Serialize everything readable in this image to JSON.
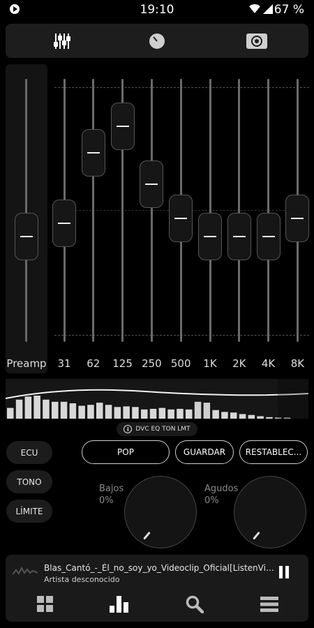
{
  "status": {
    "time": "19:10",
    "battery": "67 %"
  },
  "top_tabs": [
    {
      "name": "equalizer",
      "icon": "sliders-icon"
    },
    {
      "name": "tone",
      "icon": "dial-icon"
    },
    {
      "name": "surround",
      "icon": "speaker-icon"
    }
  ],
  "eq": {
    "preamp_label": "Preamp",
    "preamp_level": 0.4,
    "bands": [
      {
        "label": "31",
        "level": 0.45
      },
      {
        "label": "62",
        "level": 0.72
      },
      {
        "label": "125",
        "level": 0.82
      },
      {
        "label": "250",
        "level": 0.6
      },
      {
        "label": "500",
        "level": 0.47
      },
      {
        "label": "1K",
        "level": 0.4
      },
      {
        "label": "2K",
        "level": 0.4
      },
      {
        "label": "4K",
        "level": 0.4
      },
      {
        "label": "8K",
        "level": 0.47
      }
    ]
  },
  "spectrum_levels": [
    0.35,
    0.62,
    0.72,
    0.75,
    0.62,
    0.55,
    0.55,
    0.5,
    0.42,
    0.45,
    0.52,
    0.45,
    0.38,
    0.4,
    0.38,
    0.3,
    0.32,
    0.35,
    0.3,
    0.32,
    0.3,
    0.55,
    0.52,
    0.28,
    0.22,
    0.2,
    0.15,
    0.12,
    0.08,
    0.05,
    0.03,
    0.02
  ],
  "dvc_chip": "DVC EQ TON LMT",
  "side_buttons": {
    "ecu": "ECU",
    "tono": "TONO",
    "limite": "LÍMITE"
  },
  "preset_buttons": {
    "pop": "POP",
    "guardar": "GUARDAR",
    "restablecer": "RESTABLEC..."
  },
  "bass": {
    "label": "Bajos",
    "value": "0%"
  },
  "treble": {
    "label": "Agudos",
    "value": "0%"
  },
  "now_playing": {
    "title": "Blas_Cantó_-_Él_no_soy_yo_Videoclip_Oficial[ListenVid.co...",
    "artist": "Artista desconocido"
  },
  "bottom_nav": [
    "grid-icon",
    "bar-chart-icon",
    "search-icon",
    "menu-icon"
  ]
}
